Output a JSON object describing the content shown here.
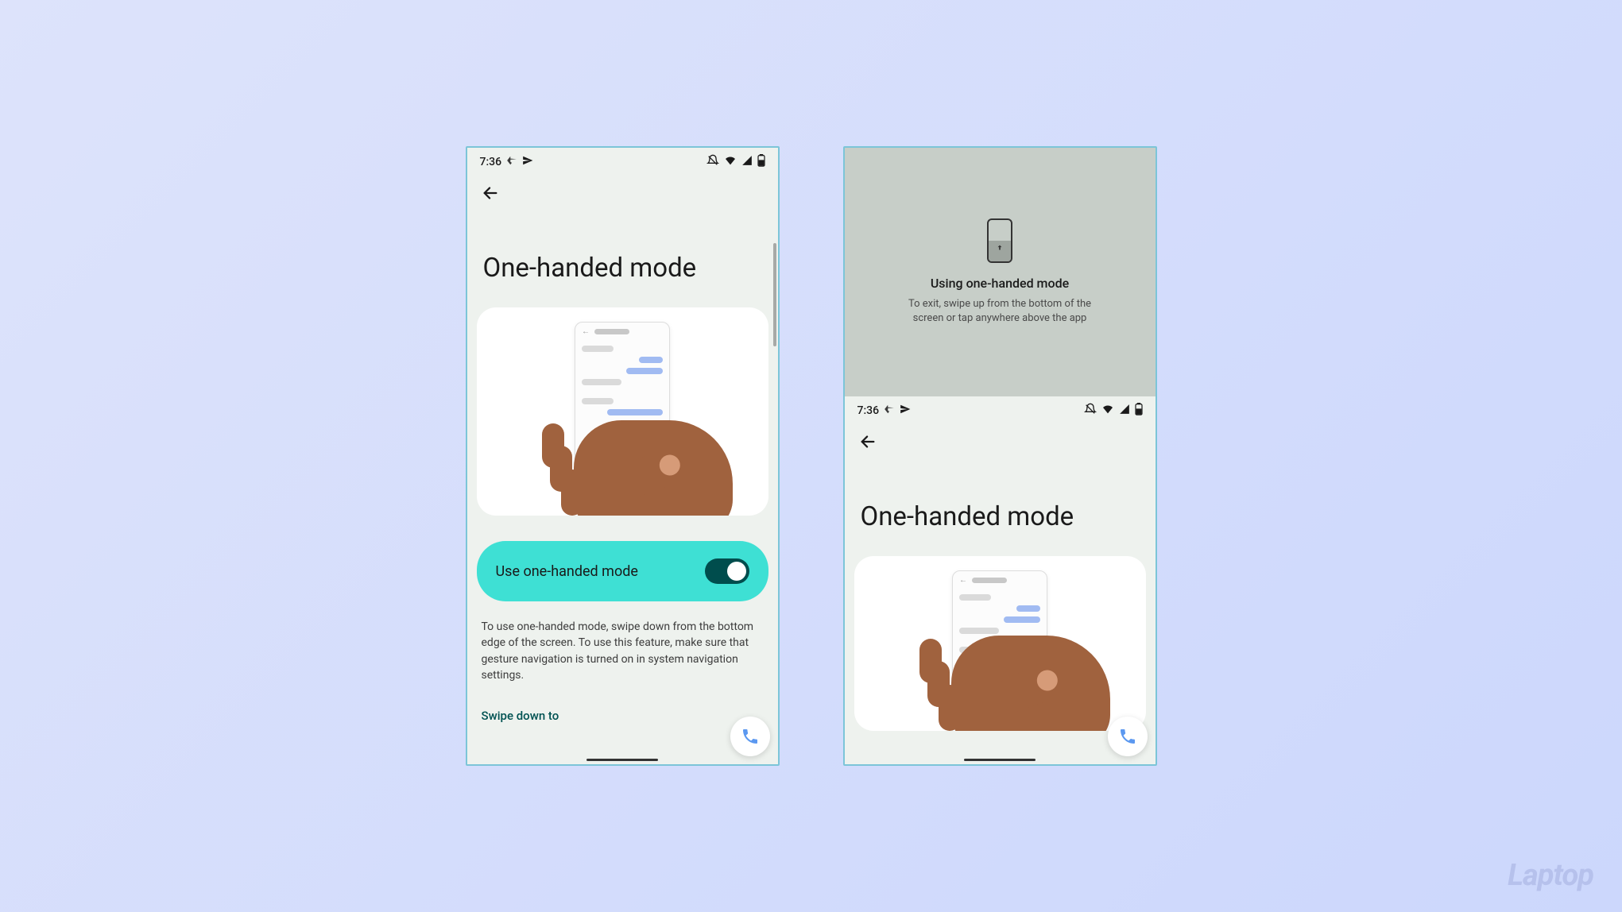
{
  "statusbar": {
    "time": "7:36"
  },
  "screen1": {
    "title": "One-handed mode",
    "toggleLabel": "Use one-handed mode",
    "helpText": "To use one-handed mode, swipe down from the bottom edge of the screen. To use this feature, make sure that gesture navigation is turned on in system navigation settings.",
    "swipeLabel": "Swipe down to"
  },
  "screen2": {
    "overlayTitle": "Using one-handed mode",
    "overlaySub": "To exit, swipe up from the bottom of the screen or tap anywhere above the app",
    "title": "One-handed mode"
  },
  "watermark": "Laptop"
}
